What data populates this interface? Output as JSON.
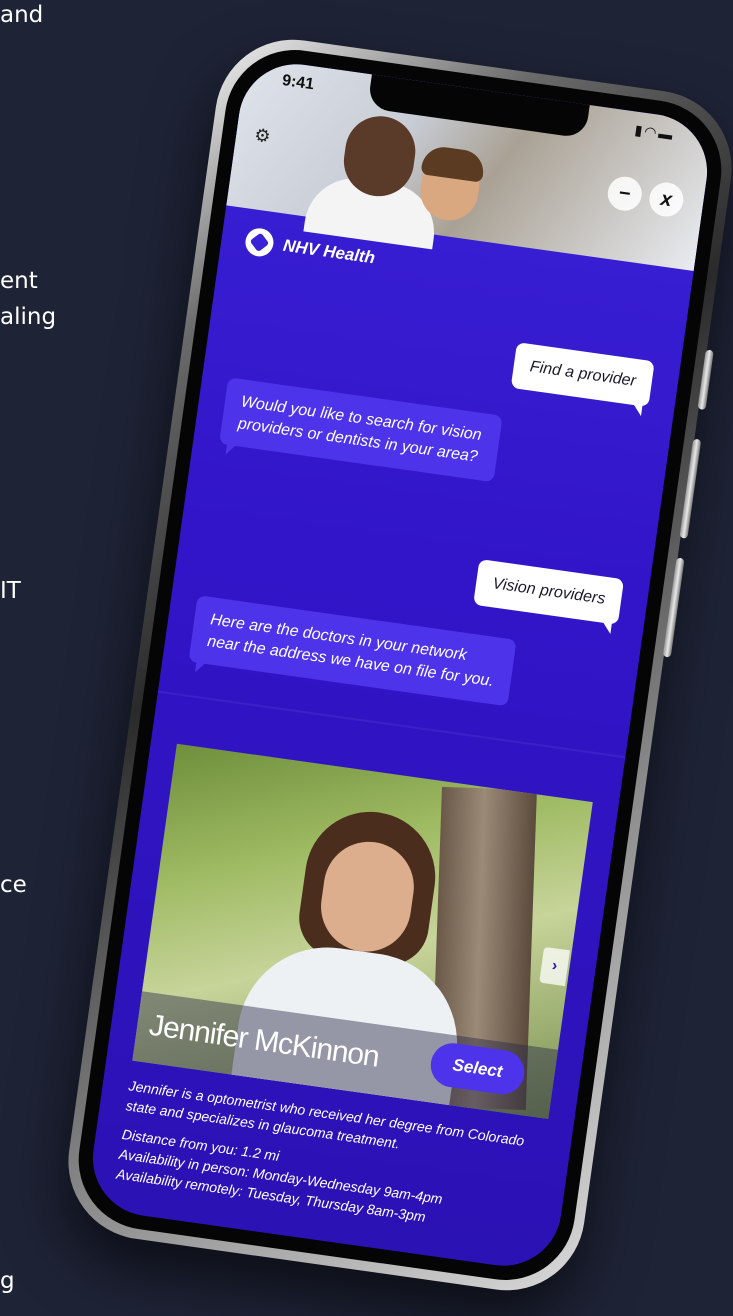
{
  "edge_text": [
    "and",
    "ent",
    "aling",
    "IT",
    "ce",
    "g"
  ],
  "status_bar": {
    "time": "9:41",
    "icons": "signal-icon wifi-icon battery-icon"
  },
  "header": {
    "minimize_label": "−",
    "close_label": "x"
  },
  "brand": {
    "name": "NHV Health"
  },
  "chat": [
    {
      "from": "user",
      "text": "Find a provider"
    },
    {
      "from": "bot",
      "text": "Would you like to search for vision providers or dentists in your area?"
    },
    {
      "from": "user",
      "text": "Vision providers"
    },
    {
      "from": "bot",
      "text": "Here are the doctors in your network near the address we have on file for you."
    }
  ],
  "provider": {
    "name": "Jennifer McKinnon",
    "select_label": "Select",
    "next_label": "›",
    "bio": "Jennifer is a optometrist who received her degree from Colorado state and specializes in glaucoma treatment.",
    "distance": "Distance from you: 1.2 mi",
    "availability_in_person": "Availability in person: Monday-Wednesday 9am-4pm",
    "availability_remote": "Availability remotely: Tuesday, Thursday 8am-3pm"
  },
  "colors": {
    "background": "#1e2336",
    "screen": "#3a22d6",
    "bot_bubble": "#4d33ea",
    "user_bubble": "#ffffff"
  }
}
